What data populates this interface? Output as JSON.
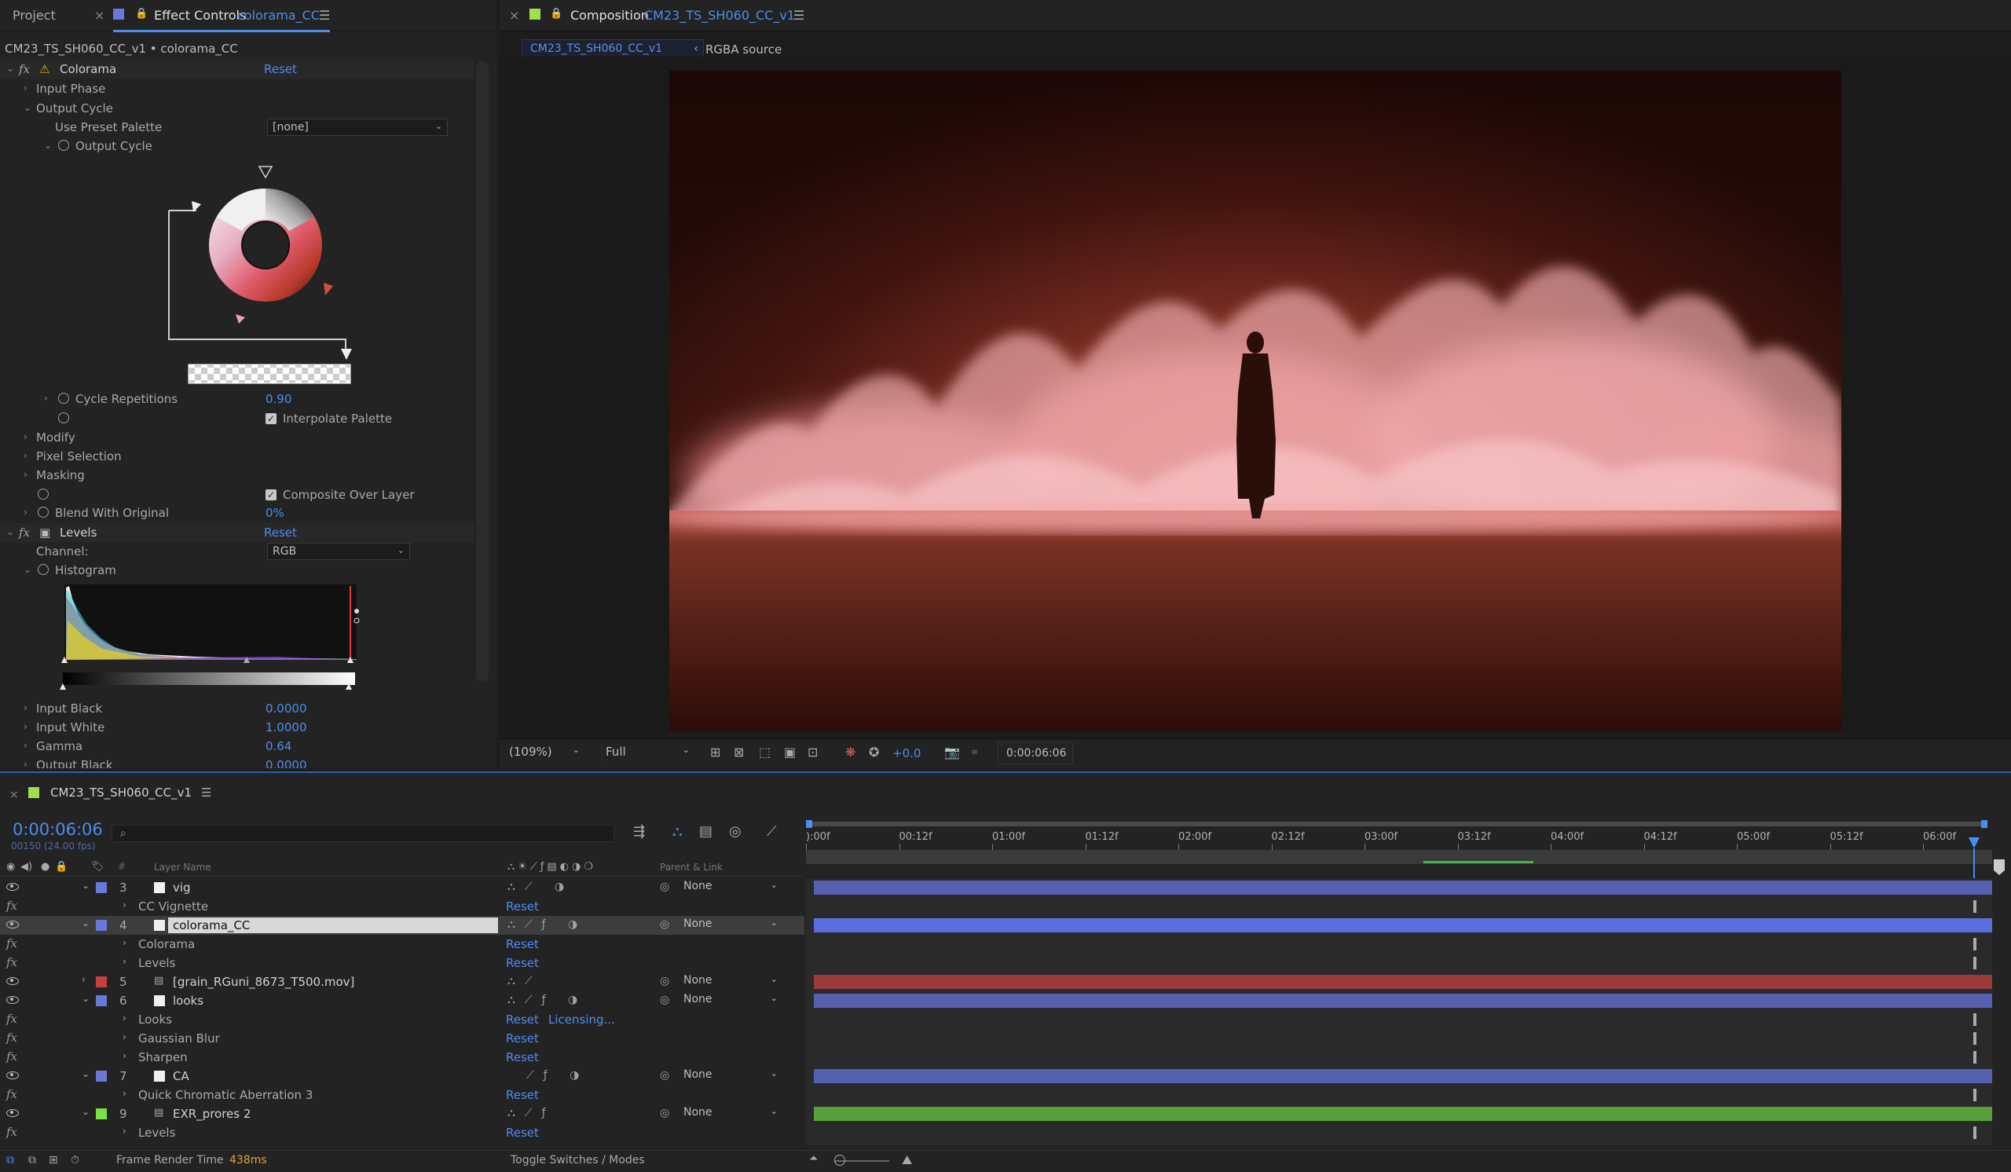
{
  "effect_controls": {
    "tab_project": "Project",
    "tab_title": "Effect Controls",
    "tab_layer": "colorama_CC",
    "breadcrumb": "CM23_TS_SH060_CC_v1 • colorama_CC",
    "colorama": {
      "name": "Colorama",
      "reset": "Reset",
      "input_phase": "Input Phase",
      "output_cycle": "Output Cycle",
      "use_preset_palette": "Use Preset Palette",
      "preset_value": "[none]",
      "output_cycle_sub": "Output Cycle",
      "cycle_repetitions": "Cycle Repetitions",
      "cycle_repetitions_value": "0.90",
      "interpolate_palette": "Interpolate Palette",
      "modify": "Modify",
      "pixel_selection": "Pixel Selection",
      "masking": "Masking",
      "composite_over_layer": "Composite Over Layer",
      "blend_with_original": "Blend With Original",
      "blend_value": "0%"
    },
    "levels": {
      "name": "Levels",
      "reset": "Reset",
      "channel_label": "Channel:",
      "channel_value": "RGB",
      "histogram": "Histogram",
      "input_black": "Input Black",
      "input_black_value": "0.0000",
      "input_white": "Input White",
      "input_white_value": "1.0000",
      "gamma": "Gamma",
      "gamma_value": "0.64",
      "output_black": "Output Black",
      "output_black_value": "0.0000"
    }
  },
  "composition": {
    "tab_title": "Composition",
    "tab_comp": "CM23_TS_SH060_CC_v1",
    "sub_tab": "CM23_TS_SH060_CC_v1",
    "rgba_label": "RGBA source",
    "zoom": "(109%)",
    "resolution": "Full",
    "exposure": "+0.0",
    "timecode": "0:00:06:06"
  },
  "timeline": {
    "comp_name": "CM23_TS_SH060_CC_v1",
    "current_time": "0:00:06:06",
    "frame_info": "00150 (24.00 fps)",
    "col_layer_name": "Layer Name",
    "col_parent": "Parent & Link",
    "ruler": [
      "):00f",
      "00:12f",
      "01:00f",
      "01:12f",
      "02:00f",
      "02:12f",
      "03:00f",
      "03:12f",
      "04:00f",
      "04:12f",
      "05:00f",
      "05:12f",
      "06:00f"
    ],
    "layers": [
      {
        "num": "3",
        "name": "vig",
        "parent": "None"
      },
      {
        "effect": "CC Vignette",
        "reset": "Reset"
      },
      {
        "num": "4",
        "name": "colorama_CC",
        "parent": "None"
      },
      {
        "effect": "Colorama",
        "reset": "Reset"
      },
      {
        "effect": "Levels",
        "reset": "Reset"
      },
      {
        "num": "5",
        "name": "[grain_RGuni_8673_T500.mov]",
        "parent": "None"
      },
      {
        "num": "6",
        "name": "looks",
        "parent": "None"
      },
      {
        "effect": "Looks",
        "reset": "Reset",
        "extra": "Licensing..."
      },
      {
        "effect": "Gaussian Blur",
        "reset": "Reset"
      },
      {
        "effect": "Sharpen",
        "reset": "Reset"
      },
      {
        "num": "7",
        "name": "CA",
        "parent": "None"
      },
      {
        "effect": "Quick Chromatic Aberration 3",
        "reset": "Reset"
      },
      {
        "num": "9",
        "name": "EXR_prores 2",
        "parent": "None"
      },
      {
        "effect": "Levels",
        "reset": "Reset"
      }
    ],
    "frame_render_label": "Frame Render Time",
    "frame_render_value": "438ms",
    "toggle_label": "Toggle Switches / Modes"
  },
  "colors": {
    "accent": "#4c8df0",
    "layer_blue": "#5660b0",
    "layer_red": "#9c3a3a",
    "layer_green": "#5aa03a"
  }
}
